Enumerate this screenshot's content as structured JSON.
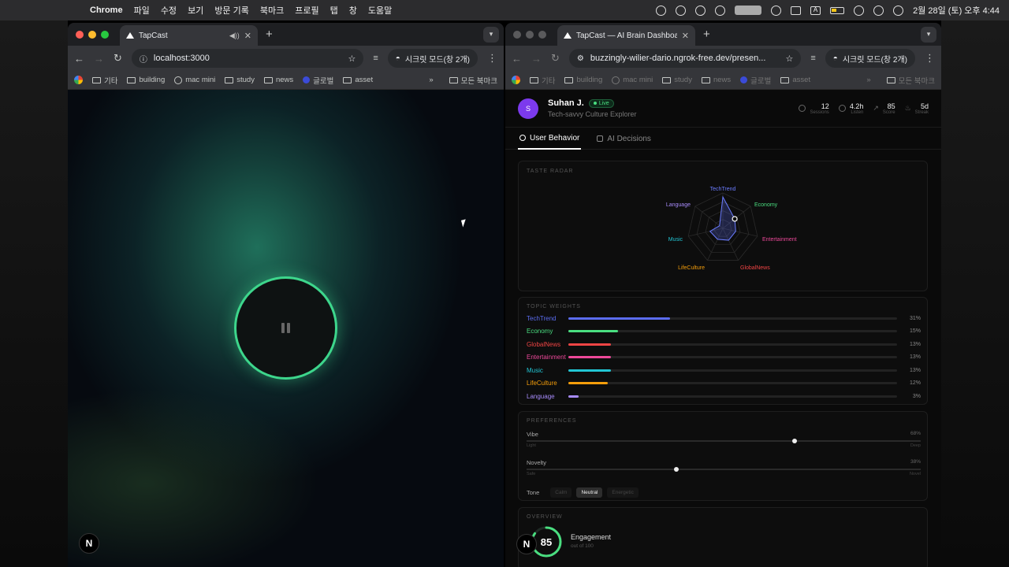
{
  "menubar": {
    "app": "Chrome",
    "items": [
      "파일",
      "수정",
      "보기",
      "방문 기록",
      "북마크",
      "프로필",
      "탭",
      "창",
      "도움말"
    ],
    "clock": "2월 28일 (토) 오후 4:44"
  },
  "left_browser": {
    "tab_title": "TapCast",
    "url": "localhost:3000",
    "incognito": "시크릿 모드(창 2개)",
    "bookmarks": [
      "기타",
      "building",
      "mac mini",
      "study",
      "news",
      "글로벌",
      "asset"
    ],
    "all_bookmarks": "모든 북마크",
    "next_badge": "N"
  },
  "right_browser": {
    "tab_title": "TapCast — AI Brain Dashboard",
    "url": "buzzingly-wilier-dario.ngrok-free.dev/presen...",
    "incognito": "시크릿 모드(창 2개)",
    "bookmarks": [
      "기타",
      "building",
      "mac mini",
      "study",
      "news",
      "글로벌",
      "asset"
    ],
    "all_bookmarks": "모든 북마크"
  },
  "dashboard": {
    "avatar": "S",
    "user_name": "Suhan J.",
    "live": "Live",
    "user_sub": "Tech-savvy Culture Explorer",
    "stats": [
      {
        "value": "12",
        "label": "Sessions"
      },
      {
        "value": "4.2h",
        "label": "Listen"
      },
      {
        "value": "85",
        "label": "Score"
      },
      {
        "value": "5d",
        "label": "Streak"
      }
    ],
    "tabs": [
      "User Behavior",
      "AI Decisions"
    ],
    "radar_title": "TASTE RADAR",
    "radar_labels": {
      "techtrend": "TechTrend",
      "economy": "Economy",
      "entertainment": "Entertainment",
      "globalnews": "GlobalNews",
      "lifeculture": "LifeCulture",
      "music": "Music",
      "language": "Language"
    },
    "weights_title": "TOPIC WEIGHTS",
    "weights": [
      {
        "label": "TechTrend",
        "value": 31,
        "pct": "31%",
        "color": "#5b6cf0"
      },
      {
        "label": "Economy",
        "value": 15,
        "pct": "15%",
        "color": "#4ade80"
      },
      {
        "label": "GlobalNews",
        "value": 13,
        "pct": "13%",
        "color": "#ef4444"
      },
      {
        "label": "Entertainment",
        "value": 13,
        "pct": "13%",
        "color": "#ec4899"
      },
      {
        "label": "Music",
        "value": 13,
        "pct": "13%",
        "color": "#22c5d4"
      },
      {
        "label": "LifeCulture",
        "value": 12,
        "pct": "12%",
        "color": "#f59e0b"
      },
      {
        "label": "Language",
        "value": 3,
        "pct": "3%",
        "color": "#a78bfa"
      }
    ],
    "prefs_title": "PREFERENCES",
    "vibe": {
      "label": "Vibe",
      "value": 68,
      "pct": "68%",
      "min": "Light",
      "max": "Deep"
    },
    "novelty": {
      "label": "Novelty",
      "value": 38,
      "pct": "38%",
      "min": "Safe",
      "max": "Novel"
    },
    "tone_label": "Tone",
    "tones": [
      "Calm",
      "Neutral",
      "Energetic"
    ],
    "overview_title": "OVERVIEW",
    "engagement_value": "85",
    "engagement_score": 85,
    "engagement_label": "Engagement",
    "engagement_sub": "out of 100",
    "next_badge": "N"
  }
}
